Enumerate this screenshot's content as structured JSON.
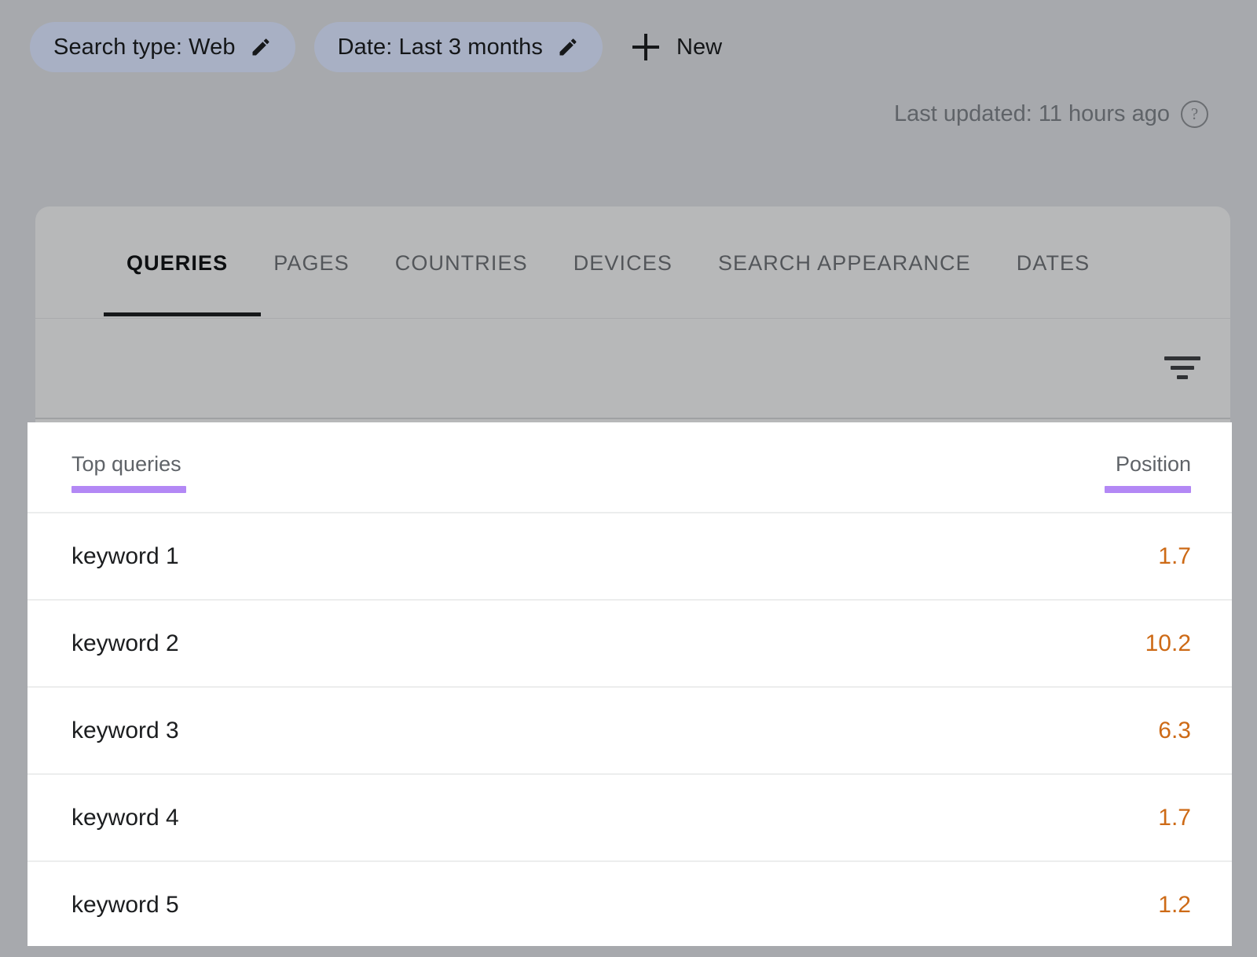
{
  "filters": {
    "chips": [
      {
        "label": "Search type: Web",
        "icon": "pencil-icon"
      },
      {
        "label": "Date: Last 3 months",
        "icon": "pencil-icon"
      }
    ],
    "new_button": {
      "label": "New",
      "icon": "plus-icon"
    }
  },
  "status": {
    "last_updated": "Last updated: 11 hours ago",
    "help_glyph": "?"
  },
  "tabs": [
    {
      "label": "QUERIES",
      "active": true
    },
    {
      "label": "PAGES",
      "active": false
    },
    {
      "label": "COUNTRIES",
      "active": false
    },
    {
      "label": "DEVICES",
      "active": false
    },
    {
      "label": "SEARCH APPEARANCE",
      "active": false
    },
    {
      "label": "DATES",
      "active": false
    }
  ],
  "toolbar": {
    "filter_icon": "filter-icon"
  },
  "table": {
    "columns": [
      {
        "label": "Top queries",
        "underline_color": "#b388f5"
      },
      {
        "label": "Position",
        "underline_color": "#b388f5"
      }
    ],
    "rows": [
      {
        "query": "keyword 1",
        "position": "1.7"
      },
      {
        "query": "keyword 2",
        "position": "10.2"
      },
      {
        "query": "keyword 3",
        "position": "6.3"
      },
      {
        "query": "keyword 4",
        "position": "1.7"
      },
      {
        "query": "keyword 5",
        "position": "1.2"
      }
    ]
  },
  "colors": {
    "page_background": "#a7a9ad",
    "chip_background": "#a8b0c4",
    "card_background": "#b7b8b9",
    "table_background": "#ffffff",
    "accent_purple": "#b388f5",
    "position_orange": "#cd6a16",
    "active_tab": "#0d0f11"
  }
}
